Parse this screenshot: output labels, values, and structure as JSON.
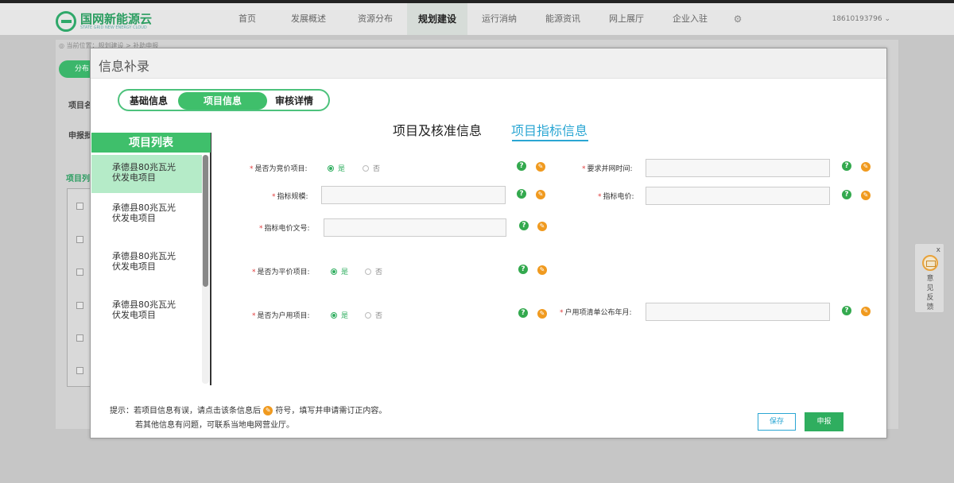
{
  "app": {
    "logo_main": "国网新能源云",
    "logo_sub": "STATE GRID NEW ENERGY CLOUD",
    "nav": [
      {
        "label": "首页"
      },
      {
        "label": "发展概述"
      },
      {
        "label": "资源分布"
      },
      {
        "label": "规划建设"
      },
      {
        "label": "运行消纳"
      },
      {
        "label": "能源资讯"
      },
      {
        "label": "网上展厅"
      },
      {
        "label": "企业入驻"
      }
    ],
    "gear_icon": "⚙",
    "phone": "18610193796 ⌄",
    "breadcrumb": "◎ 当前位置：规划建设 > 补助申报",
    "bg_button": "分布",
    "bg_labels": [
      "项目名",
      "申报批"
    ],
    "bg_list_label": "项目列"
  },
  "feedback": {
    "close": "x",
    "label": "意见反馈"
  },
  "modal": {
    "title": "信息补录",
    "steps": {
      "step1": "基础信息",
      "step2": "项目信息",
      "step3": "审核详情"
    },
    "list": {
      "title": "项目列表",
      "items": [
        {
          "label": "承德县80兆瓦光伏发电项目"
        },
        {
          "label": "承德县80兆瓦光伏发电项目"
        },
        {
          "label": "承德县80兆瓦光伏发电项目"
        },
        {
          "label": "承德县80兆瓦光伏发电项目"
        }
      ]
    },
    "tabs": {
      "tab1": "项目及核准信息",
      "tab2": "项目指标信息"
    },
    "form": {
      "bidding_label": "是否为竞价项目:",
      "grid_time_label": "要求并网时间:",
      "scale_label": "指标规模:",
      "price_label": "指标电价:",
      "price_doc_label": "指标电价文号:",
      "parity_label": "是否为平价项目:",
      "household_label": "是否为户用项目:",
      "household_date_label": "户用项清单公布年月:",
      "yes": "是",
      "no": "否",
      "bidding_value": "是",
      "parity_value": "是",
      "household_value": "是",
      "grid_time_value": "",
      "scale_value": "",
      "price_value": "",
      "price_doc_value": "",
      "household_date_value": ""
    },
    "icons": {
      "help": "?",
      "edit": "✎"
    },
    "tip_line1_a": "提示：若项目信息有误，请点击该条信息后",
    "tip_line1_b": "符号，填写并申请需订正内容。",
    "tip_line2": "若其他信息有问题，可联系当地电网营业厅。",
    "buttons": {
      "save": "保存",
      "submit": "申报"
    }
  },
  "colors": {
    "accent_green": "#3fbf6b",
    "accent_blue": "#2aa6d3",
    "edit_orange": "#f09a1f",
    "required_red": "#e03b3b"
  }
}
